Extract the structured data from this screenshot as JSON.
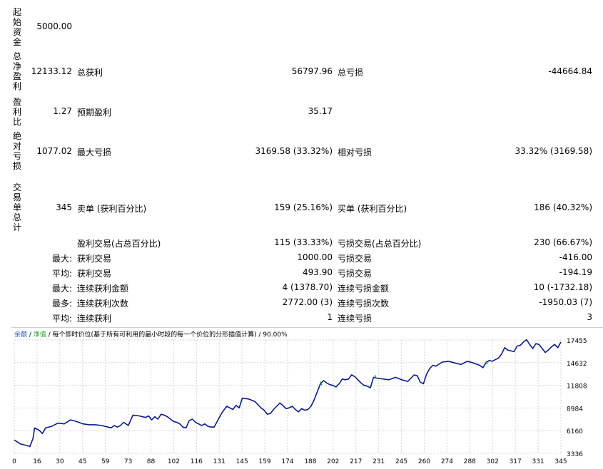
{
  "report": {
    "initial_deposit": {
      "label": "起始资金",
      "value": "5000.00"
    },
    "net_profit": {
      "label": "总净盈利",
      "value": "12133.12",
      "gross_profit_label": "总获利",
      "gross_profit_value": "56797.96",
      "gross_loss_label": "总亏损",
      "gross_loss_value": "-44664.84"
    },
    "profit_factor": {
      "label": "盈利比",
      "value": "1.27",
      "expected_payoff_label": "预期盈利",
      "expected_payoff_value": "35.17"
    },
    "drawdown": {
      "label": "绝对亏损",
      "value": "1077.02",
      "max_drawdown_label": "最大亏损",
      "max_drawdown_value": "3169.58 (33.32%)",
      "relative_drawdown_label": "相对亏损",
      "relative_drawdown_value": "33.32% (3169.58)"
    },
    "trades": {
      "label": "交易单总计",
      "value": "345",
      "short_label": "卖单 (获利百分比)",
      "short_value": "159 (25.16%)",
      "long_label": "买单 (获利百分比)",
      "long_value": "186 (40.32%)"
    },
    "profit_trades": {
      "label": "盈利交易(占总百分比)",
      "value": "115 (33.33%)",
      "loss_label": "亏损交易(占总百分比)",
      "loss_value": "230 (66.67%)"
    },
    "rows": [
      {
        "prefix": "最大:",
        "label1": "获利交易",
        "value1": "1000.00",
        "label2": "亏损交易",
        "value2": "-416.00"
      },
      {
        "prefix": "平均:",
        "label1": "获利交易",
        "value1": "493.90",
        "label2": "亏损交易",
        "value2": "-194.19"
      },
      {
        "prefix": "最大:",
        "label1": "连续获利金额",
        "value1": "4 (1378.70)",
        "label2": "连续亏损金额",
        "value2": "10 (-1732.18)"
      },
      {
        "prefix": "最多:",
        "label1": "连续获利次数",
        "value1": "2772.00 (3)",
        "label2": "连续亏损次数",
        "value2": "-1950.03 (7)"
      },
      {
        "prefix": "平均:",
        "label1": "连续获利",
        "value1": "1",
        "label2": "连续亏损",
        "value2": "3"
      }
    ]
  },
  "chart_legend": {
    "balance": "余额",
    "sep1": " / ",
    "equity": "净值",
    "rest": " / 每个即时价位(基于所有可利用的最小时段的每一个价位的分形插值计算) / 90.00%"
  },
  "colors": {
    "balance": "#0a1a8a",
    "equity": "#22a022",
    "grid": "#d6d6d6"
  },
  "chart_data": {
    "type": "line",
    "x_ticks": [
      "0",
      "16",
      "30",
      "45",
      "59",
      "73",
      "88",
      "102",
      "116",
      "131",
      "145",
      "159",
      "174",
      "188",
      "202",
      "217",
      "231",
      "245",
      "260",
      "274",
      "288",
      "302",
      "317",
      "331",
      "345"
    ],
    "y_ticks": [
      "17455",
      "14632",
      "11808",
      "8984",
      "6160",
      "3336"
    ],
    "ylim": [
      3336,
      17455
    ],
    "xlim": [
      0,
      350
    ],
    "series": [
      {
        "name": "余额",
        "points": [
          [
            0,
            5000
          ],
          [
            4,
            4500
          ],
          [
            8,
            4300
          ],
          [
            10,
            4200
          ],
          [
            12,
            5200
          ],
          [
            13,
            6500
          ],
          [
            16,
            6200
          ],
          [
            18,
            5800
          ],
          [
            20,
            6500
          ],
          [
            24,
            6700
          ],
          [
            28,
            7100
          ],
          [
            32,
            7000
          ],
          [
            36,
            7500
          ],
          [
            40,
            7300
          ],
          [
            44,
            7000
          ],
          [
            48,
            6900
          ],
          [
            52,
            6900
          ],
          [
            56,
            6800
          ],
          [
            60,
            6600
          ],
          [
            62,
            6500
          ],
          [
            64,
            6800
          ],
          [
            66,
            6600
          ],
          [
            68,
            6800
          ],
          [
            70,
            7200
          ],
          [
            73,
            6800
          ],
          [
            76,
            8100
          ],
          [
            80,
            8000
          ],
          [
            84,
            7800
          ],
          [
            86,
            8000
          ],
          [
            88,
            7500
          ],
          [
            90,
            7900
          ],
          [
            92,
            7600
          ],
          [
            94,
            8200
          ],
          [
            96,
            8100
          ],
          [
            98,
            7900
          ],
          [
            100,
            7600
          ],
          [
            102,
            7300
          ],
          [
            104,
            7200
          ],
          [
            106,
            7000
          ],
          [
            108,
            6600
          ],
          [
            110,
            6500
          ],
          [
            112,
            7400
          ],
          [
            114,
            7600
          ],
          [
            116,
            7200
          ],
          [
            118,
            7000
          ],
          [
            120,
            6800
          ],
          [
            122,
            7000
          ],
          [
            124,
            6700
          ],
          [
            126,
            6600
          ],
          [
            128,
            6600
          ],
          [
            131,
            7700
          ],
          [
            133,
            8400
          ],
          [
            136,
            9200
          ],
          [
            138,
            9000
          ],
          [
            140,
            8800
          ],
          [
            142,
            9300
          ],
          [
            144,
            9000
          ],
          [
            146,
            10200
          ],
          [
            150,
            10100
          ],
          [
            154,
            9800
          ],
          [
            158,
            9000
          ],
          [
            160,
            8700
          ],
          [
            162,
            8200
          ],
          [
            164,
            8300
          ],
          [
            166,
            8800
          ],
          [
            168,
            9200
          ],
          [
            170,
            9600
          ],
          [
            172,
            9300
          ],
          [
            174,
            8900
          ],
          [
            176,
            9000
          ],
          [
            178,
            9200
          ],
          [
            180,
            8800
          ],
          [
            182,
            8500
          ],
          [
            184,
            8900
          ],
          [
            186,
            8700
          ],
          [
            188,
            8800
          ],
          [
            190,
            9200
          ],
          [
            192,
            10000
          ],
          [
            194,
            11000
          ],
          [
            196,
            12000
          ],
          [
            198,
            12400
          ],
          [
            200,
            12100
          ],
          [
            202,
            11900
          ],
          [
            204,
            11800
          ],
          [
            206,
            11600
          ],
          [
            208,
            12000
          ],
          [
            210,
            12600
          ],
          [
            212,
            12500
          ],
          [
            214,
            12600
          ],
          [
            216,
            13100
          ],
          [
            218,
            12900
          ],
          [
            220,
            12500
          ],
          [
            222,
            12100
          ],
          [
            224,
            11800
          ],
          [
            226,
            11700
          ],
          [
            228,
            11500
          ],
          [
            230,
            12800
          ],
          [
            232,
            12700
          ],
          [
            236,
            12600
          ],
          [
            240,
            12500
          ],
          [
            244,
            12800
          ],
          [
            248,
            12500
          ],
          [
            252,
            12300
          ],
          [
            256,
            13100
          ],
          [
            258,
            13000
          ],
          [
            260,
            12200
          ],
          [
            262,
            12000
          ],
          [
            264,
            13200
          ],
          [
            266,
            13900
          ],
          [
            268,
            14300
          ],
          [
            270,
            14200
          ],
          [
            274,
            14700
          ],
          [
            278,
            14800
          ],
          [
            282,
            14600
          ],
          [
            286,
            14400
          ],
          [
            290,
            14800
          ],
          [
            294,
            14600
          ],
          [
            298,
            14300
          ],
          [
            300,
            14000
          ],
          [
            302,
            14600
          ],
          [
            304,
            14900
          ],
          [
            306,
            14800
          ],
          [
            308,
            15000
          ],
          [
            310,
            15200
          ],
          [
            312,
            15700
          ],
          [
            314,
            16500
          ],
          [
            316,
            16200
          ],
          [
            320,
            16000
          ],
          [
            322,
            16700
          ],
          [
            324,
            16800
          ],
          [
            326,
            17200
          ],
          [
            328,
            17500
          ],
          [
            330,
            16900
          ],
          [
            332,
            16400
          ],
          [
            334,
            17000
          ],
          [
            336,
            16900
          ],
          [
            338,
            16400
          ],
          [
            340,
            15900
          ],
          [
            342,
            16200
          ],
          [
            344,
            16600
          ],
          [
            346,
            16900
          ],
          [
            348,
            16500
          ],
          [
            350,
            17200
          ]
        ]
      }
    ]
  }
}
